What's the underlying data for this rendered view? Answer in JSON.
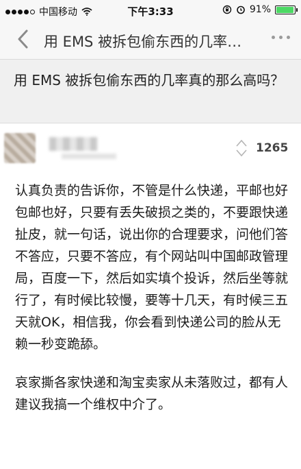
{
  "status_bar": {
    "carrier": "中国移动",
    "time": "下午3:33",
    "battery_percent": "91%",
    "battery_level": 0.91
  },
  "nav": {
    "title": "用 EMS 被拆包偷东西的几率…"
  },
  "question": {
    "title": "用 EMS 被拆包偷东西的几率真的那么高吗？"
  },
  "answer": {
    "votes": "1265",
    "paragraphs": [
      "认真负责的告诉你，不管是什么快递，平邮也好包邮也好，只要有丢失破损之类的，不要跟快递扯皮，就一句话，说出你的合理要求，问他们答不答应，只要不答应，有个网站叫中国邮政管理局，百度一下，然后如实填个投诉，然后坐等就行了，有时候比较慢，要等十几天，有时候三五天就OK，相信我，你会看到快递公司的脸从无赖一秒变跪舔。",
      "哀家撕各家快递和淘宝卖家从未落败过，都有人建议我搞一个维权中介了。"
    ]
  },
  "icons": [
    "signal-icon",
    "wifi-icon",
    "lock-rotation-icon",
    "alarm-icon",
    "battery-icon",
    "back-icon",
    "more-icon",
    "vote-icon"
  ],
  "colors": {
    "battery_fill": "#4cd964",
    "question_bg": "#f0f0f0",
    "nav_bg": "#f7f7f7"
  }
}
